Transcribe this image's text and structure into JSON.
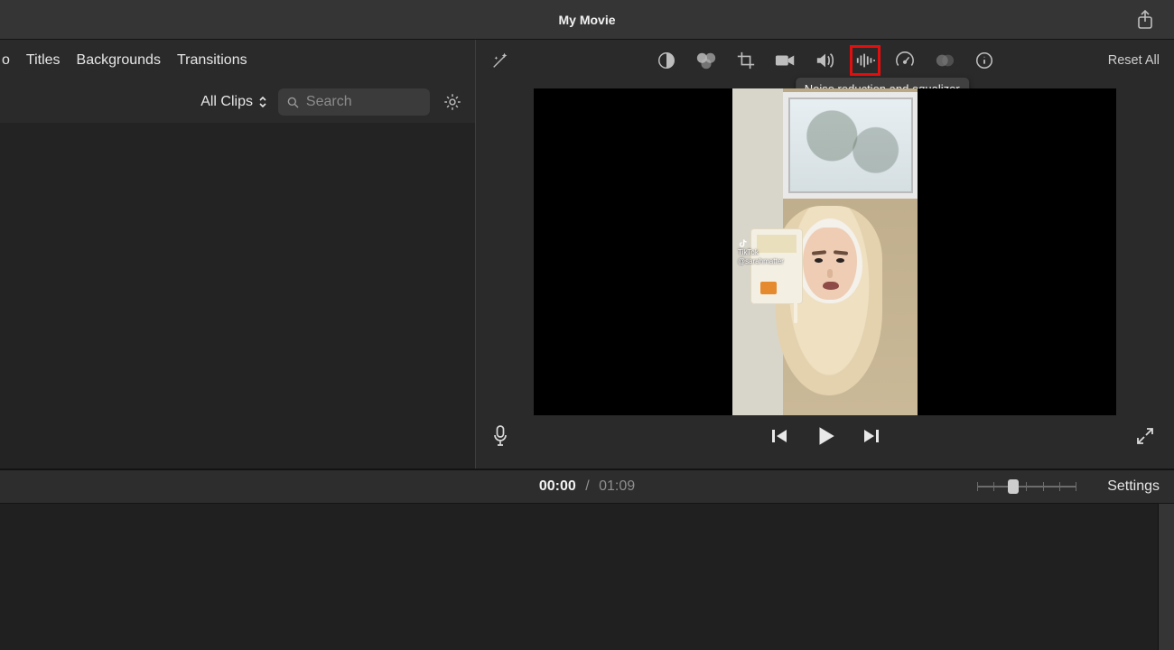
{
  "window": {
    "title": "My Movie"
  },
  "left": {
    "tabs": {
      "cutoff": "o",
      "titles": "Titles",
      "backgrounds": "Backgrounds",
      "transitions": "Transitions"
    },
    "filter_label": "All Clips",
    "search_placeholder": "Search"
  },
  "tools": {
    "reset_label": "Reset All",
    "tooltip_eq": "Noise reduction and equalizer"
  },
  "playback": {
    "current": "00:00",
    "separator": "/",
    "duration": "01:09"
  },
  "status": {
    "settings_label": "Settings"
  },
  "watermark": {
    "app": "TikTok",
    "handle": "@sarahmatter"
  }
}
